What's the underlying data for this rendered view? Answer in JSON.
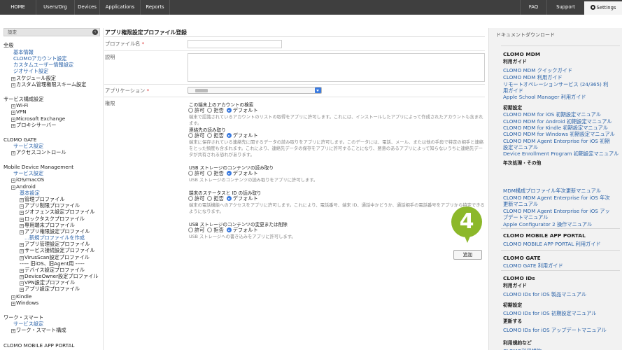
{
  "topnav": {
    "items": [
      "HOME",
      "Users/Org",
      "Devices",
      "Applications",
      "Reports"
    ],
    "right": [
      "FAQ",
      "Support"
    ],
    "settings": "Settings"
  },
  "sidebar": {
    "header": "設定",
    "items": [
      {
        "text": "全般",
        "kind": "head"
      },
      {
        "text": "基本情報",
        "kind": "link"
      },
      {
        "text": "CLOMOアカウント設定",
        "kind": "link"
      },
      {
        "text": "カスタムユーザー情報設定",
        "kind": "link"
      },
      {
        "text": "ジオサイト設定",
        "kind": "link"
      },
      {
        "text": "スケジュール設定",
        "kind": "tree"
      },
      {
        "text": "カスタム管理権限スキーム設定",
        "kind": "tree"
      },
      {
        "text": "サービス構成設定",
        "kind": "head"
      },
      {
        "text": "Wi-Fi",
        "kind": "tree"
      },
      {
        "text": "VPN",
        "kind": "tree"
      },
      {
        "text": "Microsoft Exchange",
        "kind": "tree"
      },
      {
        "text": "プロキシサーバー",
        "kind": "tree"
      },
      {
        "text": "CLOMO GATE",
        "kind": "head"
      },
      {
        "text": "サービス設定",
        "kind": "link"
      },
      {
        "text": "アクセスコントロール",
        "kind": "tree"
      },
      {
        "text": "Mobile Device Management",
        "kind": "head"
      },
      {
        "text": "サービス設定",
        "kind": "link"
      },
      {
        "text": "iOS/macOS",
        "kind": "tree"
      },
      {
        "text": "Android",
        "kind": "tree"
      },
      {
        "text": "基本設定",
        "kind": "link"
      },
      {
        "text": "管理プロファイル",
        "kind": "tree"
      },
      {
        "text": "アプリ制限プロファイル",
        "kind": "tree"
      },
      {
        "text": "ジオフェンス設定プロファイル",
        "kind": "tree"
      },
      {
        "text": "ロックタスクプロファイル",
        "kind": "tree"
      },
      {
        "text": "専用端末プロファイル",
        "kind": "tree"
      },
      {
        "text": "アプリ権限設定プロファイル",
        "kind": "tree"
      },
      {
        "text": "...新規プロファイルを作成",
        "kind": "link"
      },
      {
        "text": "アプリ管理設定プロファイル",
        "kind": "tree"
      },
      {
        "text": "サービス接続設定プロファイル",
        "kind": "tree"
      },
      {
        "text": "VirusScan設定プロファイル",
        "kind": "tree"
      },
      {
        "text": "----- 旧iOS、旧Agent用 -----",
        "kind": "plain"
      },
      {
        "text": "デバイス設定プロファイル",
        "kind": "tree"
      },
      {
        "text": "DeviceOwner設定プロファイル",
        "kind": "tree"
      },
      {
        "text": "VPN設定プロファイル",
        "kind": "tree"
      },
      {
        "text": "アプリ設定プロファイル",
        "kind": "tree"
      },
      {
        "text": "Kindle",
        "kind": "tree"
      },
      {
        "text": "Windows",
        "kind": "tree"
      },
      {
        "text": "ワーク・スマート",
        "kind": "head"
      },
      {
        "text": "サービス設定",
        "kind": "link"
      },
      {
        "text": "ワーク・スマート構成",
        "kind": "tree"
      },
      {
        "text": "CLOMO MOBILE APP PORTAL",
        "kind": "head"
      }
    ]
  },
  "main": {
    "title": "アプリ権限設定プロファイル登録",
    "profile_name_label": "プロファイル名",
    "description_label": "説明",
    "application_label": "アプリケーション",
    "permission_label": "権限",
    "required_mark": "*",
    "radio_options": [
      "許可",
      "拒否",
      "デフォルト"
    ],
    "permissions": [
      {
        "title": "この端末上のアカウントの検索",
        "desc": "端末で認識されているアカウントのリストの取得をアプリに許可します。これには、インストールしたアプリによって作成されたアカウントも含まれます。"
      },
      {
        "title": "連絡先の読み取り",
        "desc": "端末に保存されている連絡先に関するデータの読み取りをアプリに許可します。このデータには、電話、メール、または他の手段で特定の相手と連絡をとった頻度も含まれます。これにより、連絡先データの保存をアプリに許可することになり、悪意のあるアプリによって知らないうちに連絡先データが共有される恐れがあります。"
      },
      {
        "title": "USB ストレージのコンテンツの読み取り",
        "desc": "USB ストレージのコンテンツの読み取りをアプリに許可します。"
      },
      {
        "title": "端末のステータスと ID の読み取り",
        "desc": "端末の電話機能へのアクセスをアプリに許可します。これにより、電話番号、端末 ID、通話中かどうか、通話相手の電話番号をアプリから特定できるようになります。"
      },
      {
        "title": "USB ストレージのコンテンツの変更または削除",
        "desc": "USB ストレージへの書き込みをアプリに許可します。"
      }
    ],
    "step_number": "4",
    "add_button": "追加"
  },
  "right_panel": {
    "title": "ドキュメントダウンロード",
    "lines": [
      {
        "text": "CLOMO MDM",
        "kind": "sec"
      },
      {
        "text": "利用ガイド",
        "kind": "sub"
      },
      {
        "text": "CLOMO MDM クイックガイド",
        "kind": "link"
      },
      {
        "text": "CLOMO MDM 利用ガイド",
        "kind": "link"
      },
      {
        "text": "リモートオペレーションサービス (24/365) 利",
        "kind": "link"
      },
      {
        "text": "用ガイド",
        "kind": "link"
      },
      {
        "text": "Apple School Manager 利用ガイド",
        "kind": "link"
      },
      {
        "text": "初期設定",
        "kind": "sub"
      },
      {
        "text": "CLOMO MDM for iOS 初期設定マニュアル",
        "kind": "link"
      },
      {
        "text": "CLOMO MDM for Android 初期設定マニュアル",
        "kind": "link"
      },
      {
        "text": "CLOMO MDM for Kindle 初期設定マニュアル",
        "kind": "link"
      },
      {
        "text": "CLOMO MDM for Windows 初期設定マニュアル",
        "kind": "link"
      },
      {
        "text": "CLOMO MDM Agent Enterprise for iOS 初期",
        "kind": "link"
      },
      {
        "text": "設定マニュアル",
        "kind": "link"
      },
      {
        "text": "Device Enrollment Program 初期設定マニュアル",
        "kind": "link"
      },
      {
        "text": "年次処理・その他",
        "kind": "sub"
      },
      {
        "text": "MDM構成プロファイル年次更新マニュアル",
        "kind": "link"
      },
      {
        "text": "CLOMO MDM Agent Enterprise for iOS 年次",
        "kind": "link"
      },
      {
        "text": "更新マニュアル",
        "kind": "link"
      },
      {
        "text": "CLOMO MDM Agent Enterprise for iOS アッ",
        "kind": "link"
      },
      {
        "text": "プデートマニュアル",
        "kind": "link"
      },
      {
        "text": "Apple Configurator 2 操作マニュアル",
        "kind": "link"
      },
      {
        "text": "CLOMO MOBILE APP PORTAL",
        "kind": "sec"
      },
      {
        "text": "CLOMO MOBILE APP PORTAL 利用ガイド",
        "kind": "link"
      },
      {
        "text": "CLOMO GATE",
        "kind": "sec"
      },
      {
        "text": "CLOMO GATE 利用ガイド",
        "kind": "link"
      },
      {
        "text": "CLOMO IDs",
        "kind": "sec"
      },
      {
        "text": "利用ガイド",
        "kind": "sub"
      },
      {
        "text": "CLOMO IDs for iOS 製品マニュアル",
        "kind": "link"
      },
      {
        "text": "初期設定",
        "kind": "sub"
      },
      {
        "text": "CLOMO IDs for iOS 初期設定マニュアル",
        "kind": "link"
      },
      {
        "text": "更新する",
        "kind": "sub"
      },
      {
        "text": "CLOMO IDs for iOS アップデートマニュアル",
        "kind": "link"
      },
      {
        "text": "利用規約など",
        "kind": "sub"
      },
      {
        "text": "CLOMO利用規約",
        "kind": "link"
      }
    ]
  }
}
